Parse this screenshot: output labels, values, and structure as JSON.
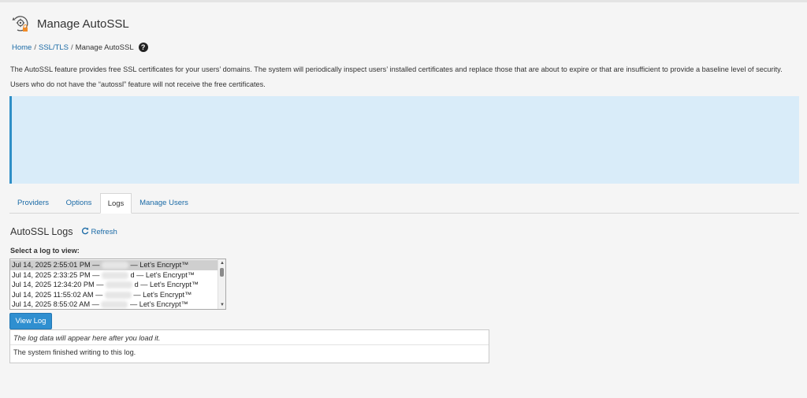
{
  "header": {
    "title": "Manage AutoSSL",
    "logo_icon": "autossl-gear-lock-icon"
  },
  "breadcrumb": {
    "items": [
      "Home",
      "SSL/TLS"
    ],
    "current": "Manage AutoSSL",
    "separator": "/",
    "help_icon": "question-circle-icon",
    "help_glyph": "?"
  },
  "description": {
    "line1": "The AutoSSL feature provides free SSL certificates for your users’ domains. The system will periodically inspect users’ installed certificates and replace those that are about to expire or that are insufficient to provide a baseline level of security.",
    "line2": "Users who do not have the “autossl” feature will not receive the free certificates."
  },
  "tabs": [
    "Providers",
    "Options",
    "Logs",
    "Manage Users"
  ],
  "active_tab": "Logs",
  "logs": {
    "title": "AutoSSL Logs",
    "refresh_label": "Refresh",
    "refresh_icon": "refresh-icon",
    "select_label": "Select a log to view:",
    "options": [
      {
        "date": "Jul 14, 2025 2:55:01 PM —",
        "tail": "— Let’s Encrypt™"
      },
      {
        "date": "Jul 14, 2025 2:33:25 PM —",
        "tail": "d — Let’s Encrypt™"
      },
      {
        "date": "Jul 14, 2025 12:34:20 PM —",
        "tail": "d — Let’s Encrypt™"
      },
      {
        "date": "Jul 14, 2025 11:55:02 AM —",
        "tail": "— Let’s Encrypt™"
      },
      {
        "date": "Jul 14, 2025 8:55:02 AM —",
        "tail": "— Let’s Encrypt™"
      }
    ],
    "view_button": "View Log",
    "output_hint": "The log data will appear here after you load it.",
    "output_message": "The system finished writing to this log."
  },
  "colors": {
    "link": "#1a6aa6",
    "info_bg": "#d9ecf9",
    "info_border": "#2f8fc7",
    "button": "#2f8fd0"
  }
}
